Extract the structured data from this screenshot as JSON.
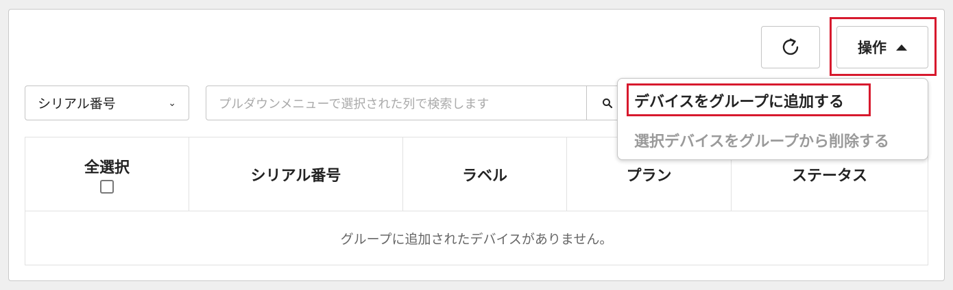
{
  "toolbar": {
    "refresh_icon": "refresh-icon",
    "ops_label": "操作",
    "ops_icon": "caret-up-icon"
  },
  "search": {
    "column_select": "シリアル番号",
    "placeholder": "プルダウンメニューで選択された列で検索します",
    "search_icon": "search-icon"
  },
  "menu": {
    "items": [
      {
        "label": "デバイスをグループに追加する",
        "enabled": true
      },
      {
        "label": "選択デバイスをグループから削除する",
        "enabled": false
      }
    ]
  },
  "table": {
    "columns": [
      "全選択",
      "シリアル番号",
      "ラベル",
      "プラン",
      "ステータス"
    ],
    "empty_message": "グループに追加されたデバイスがありません。"
  },
  "colors": {
    "highlight": "#d7192d",
    "disabled_text": "#9a9a9a"
  }
}
